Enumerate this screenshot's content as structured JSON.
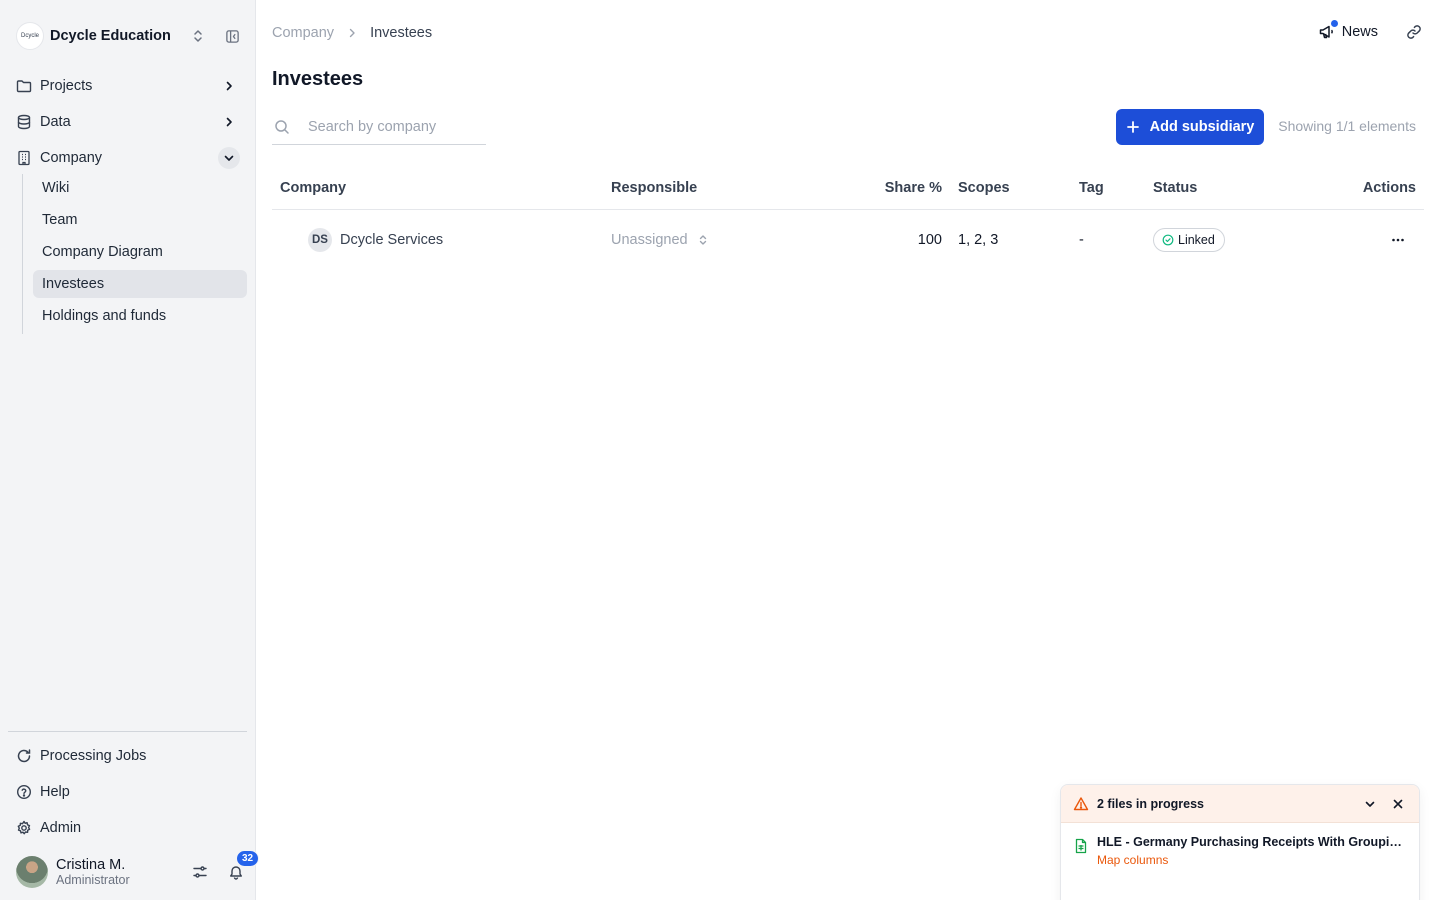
{
  "org": {
    "logo_text": "Dcycle",
    "name": "Dcycle Education"
  },
  "nav": {
    "projects": "Projects",
    "data": "Data",
    "company": "Company",
    "sub": [
      "Wiki",
      "Team",
      "Company Diagram",
      "Investees",
      "Holdings and funds"
    ],
    "active_sub": "Investees"
  },
  "bottom_nav": {
    "processing": "Processing Jobs",
    "help": "Help",
    "admin": "Admin"
  },
  "user": {
    "name": "Cristina M.",
    "role": "Administrator",
    "notifications": "32"
  },
  "breadcrumb": {
    "parent": "Company",
    "current": "Investees"
  },
  "topbar": {
    "news": "News"
  },
  "page": {
    "title": "Investees"
  },
  "search": {
    "placeholder": "Search by company",
    "value": ""
  },
  "toolbar": {
    "add_label": "Add subsidiary",
    "showing": "Showing 1/1 elements"
  },
  "table": {
    "headers": {
      "company": "Company",
      "responsible": "Responsible",
      "share": "Share %",
      "scopes": "Scopes",
      "tag": "Tag",
      "status": "Status",
      "actions": "Actions"
    },
    "rows": [
      {
        "initials": "DS",
        "company": "Dcycle Services",
        "responsible": "Unassigned",
        "share": "100",
        "scopes": "1, 2, 3",
        "tag": "-",
        "status": "Linked"
      }
    ]
  },
  "toast": {
    "title": "2 files in progress",
    "file_name": "HLE - Germany Purchasing Receipts With Grouping…",
    "file_action": "Map columns"
  },
  "colors": {
    "primary": "#1d4ed8",
    "sidebar_bg": "#f3f4f6",
    "warning": "#ea580c",
    "linked": "#10b981"
  }
}
